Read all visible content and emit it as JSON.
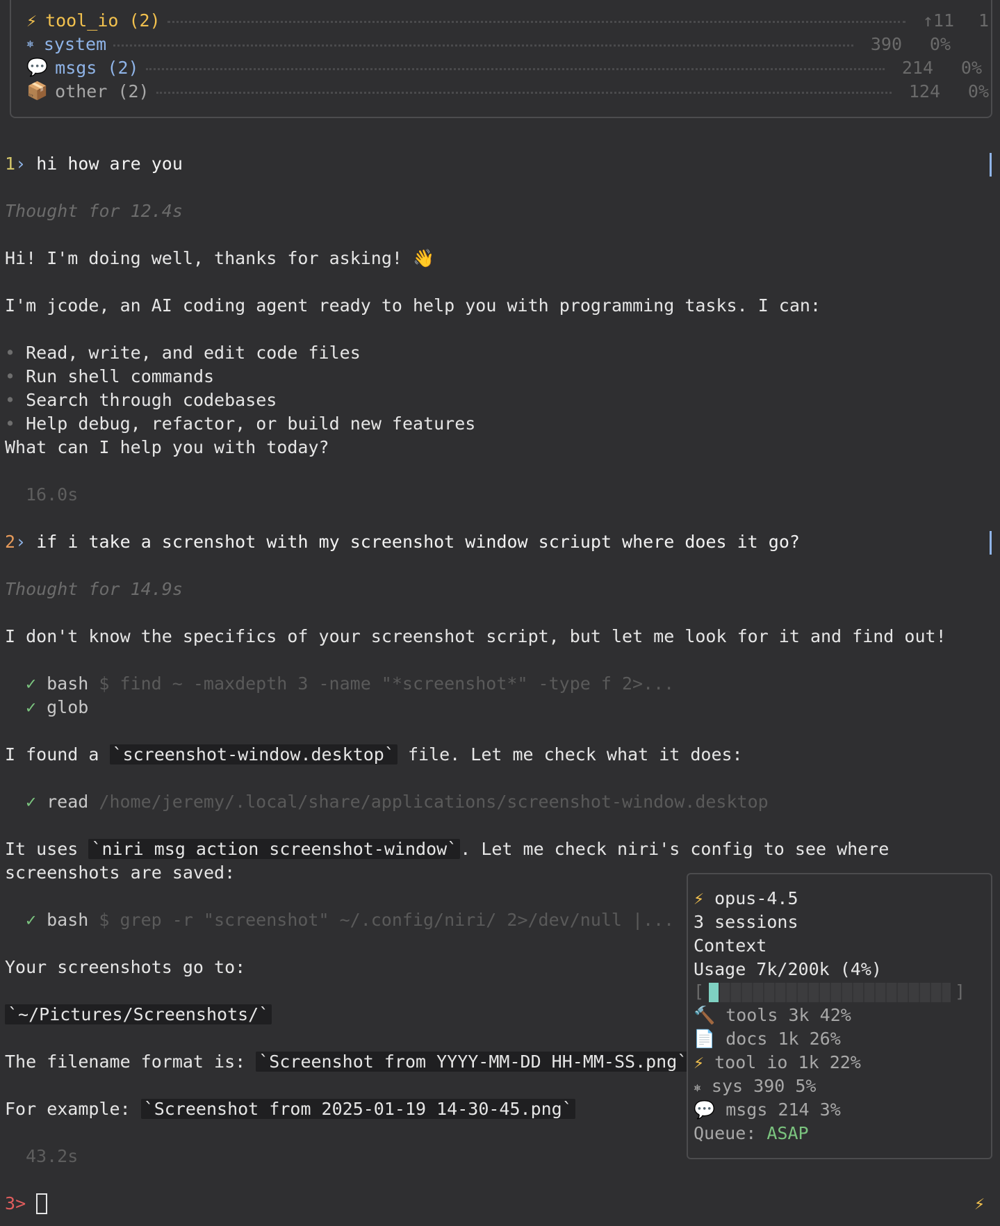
{
  "context_panel": {
    "rows": [
      {
        "icon": "⚡",
        "label": "tool_io (2)",
        "value": "↑11",
        "percent": "1",
        "color": "#f2c14e"
      },
      {
        "icon": "⎈",
        "label": "system",
        "value": "390",
        "percent": "0%",
        "color": "#8fb4e8"
      },
      {
        "icon": "💬",
        "label": "msgs (2)",
        "value": "214",
        "percent": "0%",
        "color": "#8fb4e8"
      },
      {
        "icon": "📦",
        "label": "other (2)",
        "value": "124",
        "percent": "0%",
        "color": "#9a9a9a"
      }
    ]
  },
  "conversation": {
    "turn1": {
      "number": "1",
      "prompt_symbol": "›",
      "user_message": "hi how are you",
      "thought": "Thought for 12.4s",
      "reply_greeting": "Hi! I'm doing well, thanks for asking! 👋",
      "reply_intro": "I'm jcode, an AI coding agent ready to help you with programming tasks. I can:",
      "bullets": [
        "Read, write, and edit code files",
        "Run shell commands",
        "Search through codebases",
        "Help debug, refactor, or build new features"
      ],
      "reply_question": "What can I help you with today?",
      "duration": "16.0s"
    },
    "turn2": {
      "number": "2",
      "prompt_symbol": "›",
      "user_message": "if i take a screnshot with my screenshot window scriupt where does it go?",
      "thought": "Thought for 14.9s",
      "reply_1": "I don't know the specifics of your screenshot script, but let me look for it and find out!",
      "tool_1": {
        "name": "bash",
        "detail": "$ find ~ -maxdepth 3 -name \"*screenshot*\" -type f 2>..."
      },
      "tool_2": {
        "name": "glob",
        "detail": ""
      },
      "reply_2_pre": "I found a ",
      "reply_2_code": "`screenshot-window.desktop`",
      "reply_2_post": " file. Let me check what it does:",
      "tool_3": {
        "name": "read",
        "detail": "/home/jeremy/.local/share/applications/screenshot-window.desktop"
      },
      "reply_3_pre": "It uses ",
      "reply_3_code": "`niri msg action screenshot-window`",
      "reply_3_post": ". Let me check niri's config to see where",
      "reply_3_line2": "screenshots are saved:",
      "tool_4": {
        "name": "bash",
        "detail": "$ grep -r \"screenshot\" ~/.config/niri/ 2>/dev/null |..."
      },
      "reply_4": "Your screenshots go to:",
      "reply_5_code": "`~/Pictures/Screenshots/`",
      "reply_6_pre": "The filename format is: ",
      "reply_6_code": "`Screenshot from YYYY-MM-DD HH-MM-SS.png`",
      "reply_7_pre": "For example: ",
      "reply_7_code": "`Screenshot from 2025-01-19 14-30-45.png`",
      "duration": "43.2s"
    },
    "input": {
      "number": "3",
      "prompt_symbol": ">",
      "value": ""
    }
  },
  "info_panel": {
    "model": "opus-4.5",
    "sessions": "3 sessions",
    "context_title": "Context",
    "usage": "Usage 7k/200k (4%)",
    "usage_fraction": 0.04,
    "bar_open": "[",
    "bar_close": "]",
    "breakdown": [
      {
        "icon": "🔨",
        "label": "tools 3k 42%"
      },
      {
        "icon": "📄",
        "label": "docs 1k 26%"
      },
      {
        "icon": "⚡",
        "label": "tool io 1k 22%"
      },
      {
        "icon": "⎈",
        "label": "sys 390 5%"
      },
      {
        "icon": "💬",
        "label": "msgs 214 3%"
      }
    ],
    "queue_label": "Queue: ",
    "queue_value": "ASAP"
  },
  "status": {
    "icon": "⚡"
  },
  "icons": {
    "check": "✓",
    "bullet": "•"
  },
  "colors": {
    "accent_blue": "#8fb4e8",
    "accent_yellow": "#f2c14e",
    "success_green": "#7bc47f",
    "turn_orange": "#e69a5a",
    "turn_red": "#e05d5d",
    "bar_fill": "#7fd1c2"
  }
}
